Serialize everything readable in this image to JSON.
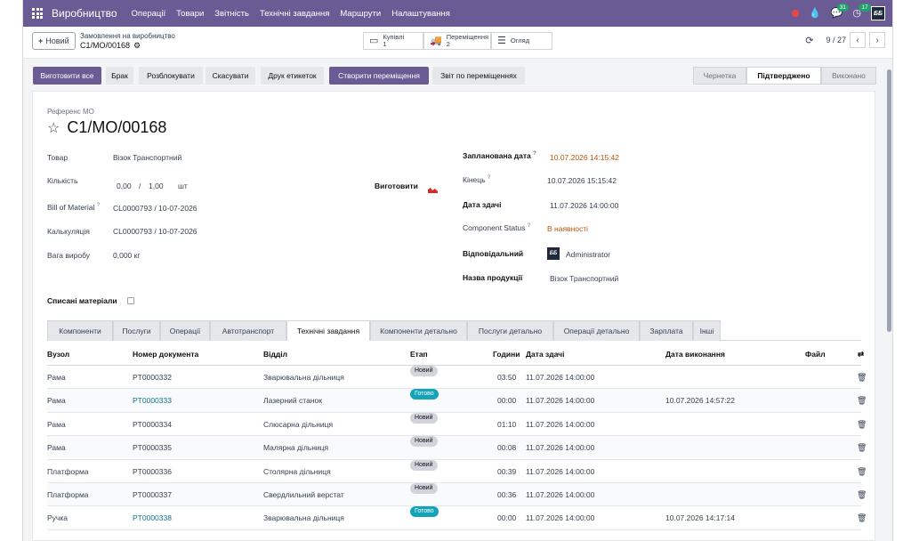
{
  "navbar": {
    "brand": "Виробництво",
    "menu": [
      "Операції",
      "Товари",
      "Звітність",
      "Технічні завдання",
      "Маршрути",
      "Налаштування"
    ],
    "messages_count": "31",
    "activity_count": "17",
    "company_logo": "ББ"
  },
  "control_panel": {
    "new_button": "Новий",
    "breadcrumb_parent": "Замовлення на виробництво",
    "breadcrumb_current": "C1/MO/00168",
    "smart_buttons": [
      {
        "icon": "card-icon",
        "label": "Купівлі",
        "count": "1"
      },
      {
        "icon": "truck-icon",
        "label": "Переміщення",
        "count": "2"
      },
      {
        "icon": "list-icon",
        "label": "Огляд",
        "count": ""
      }
    ],
    "pager": "9 / 27"
  },
  "action_buttons": [
    "Виготовити все",
    "Брак",
    "Розблокувати",
    "Скасувати",
    "Друк етикеток",
    "Створити переміщення",
    "Звіт по переміщеннях"
  ],
  "statusbar": [
    "Чернетка",
    "Підтверджено",
    "Виконано"
  ],
  "form": {
    "ref_label": "Референс МО",
    "ref": "C1/MO/00168",
    "product_label": "Товар",
    "product": "Візок Транспортний",
    "qty_label": "Кількість",
    "qty_done": "0,00",
    "qty_sep": "/",
    "qty_total": "1,00",
    "qty_uom": "шт",
    "produce_label": "Виготовити",
    "bom_label": "Bill of Material",
    "bom": "CL0000793 / 10-07-2026",
    "costing_label": "Калькуляція",
    "costing": "CL0000793 / 10-07-2026",
    "weight_label": "Вага виробу",
    "weight": "0,000 кг",
    "scrapped_label": "Списані матеріали",
    "planned_date_label": "Запланована дата",
    "planned_date": "10.07.2026 14:15:42",
    "end_label": "Кінець",
    "end": "10.07.2026 15:15:42",
    "deadline_label": "Дата здачі",
    "deadline": "11.07.2026 14:00:00",
    "component_status_label": "Component Status",
    "component_status": "В наявності",
    "responsible_label": "Відповідальний",
    "responsible": "Administrator",
    "product_name_label": "Назва продукції",
    "product_name": "Візок Транспортний"
  },
  "tabs": [
    "Компоненти",
    "Послуги",
    "Операції",
    "Автотранспорт",
    "Технічні завдання",
    "Компоненти детально",
    "Послуги детально",
    "Операції детально",
    "Зарплата",
    "Інші"
  ],
  "table": {
    "headers": [
      "Вузол",
      "Номер документа",
      "Відділ",
      "Етап",
      "Години",
      "Дата здачі",
      "Дата виконання",
      "Файл"
    ],
    "rows": [
      {
        "node": "Рама",
        "doc": "PT0000332",
        "dept": "Зварювальна дільниця",
        "stage": "Новий",
        "hours": "03:50",
        "due": "11.07.2026 14:00:00",
        "done": ""
      },
      {
        "node": "Рама",
        "doc": "PT0000333",
        "dept": "Лазерний станок",
        "stage": "Готово",
        "hours": "00:00",
        "due": "11.07.2026 14:00:00",
        "done": "10.07.2026 14:57:22"
      },
      {
        "node": "Рама",
        "doc": "PT0000334",
        "dept": "Слюсарна дільниця",
        "stage": "Новий",
        "hours": "01:10",
        "due": "11.07.2026 14:00:00",
        "done": ""
      },
      {
        "node": "Рама",
        "doc": "PT0000335",
        "dept": "Малярна дільниця",
        "stage": "Новий",
        "hours": "00:08",
        "due": "11.07.2026 14:00:00",
        "done": ""
      },
      {
        "node": "Платформа",
        "doc": "PT0000336",
        "dept": "Столярна дільниця",
        "stage": "Новий",
        "hours": "00:39",
        "due": "11.07.2026 14:00:00",
        "done": ""
      },
      {
        "node": "Платформа",
        "doc": "PT0000337",
        "dept": "Свердлильний верстат",
        "stage": "Новий",
        "hours": "00:36",
        "due": "11.07.2026 14:00:00",
        "done": ""
      },
      {
        "node": "Ручка",
        "doc": "PT0000338",
        "dept": "Зварювальна дільниця",
        "stage": "Готово",
        "hours": "00:00",
        "due": "11.07.2026 14:00:00",
        "done": "10.07.2026 14:17:14"
      }
    ]
  },
  "colors": {
    "brand": "#6b5b95",
    "link": "#0e7490",
    "done_badge": "#14a3b8",
    "warning_text": "#b45309"
  }
}
